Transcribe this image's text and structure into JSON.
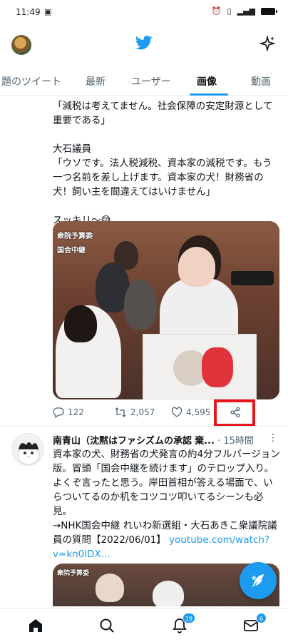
{
  "status_bar": {
    "time": "11:49",
    "left_icon": "sim-card-icon",
    "right_icons": [
      "alarm-icon",
      "vibrate-icon",
      "signal-icon",
      "battery-icon"
    ]
  },
  "header": {
    "logo": "twitter-bird-icon",
    "right_icon": "sparkle-icon"
  },
  "tabs": [
    {
      "label": "題のツイート",
      "active": false
    },
    {
      "label": "最新",
      "active": false
    },
    {
      "label": "ユーザー",
      "active": false
    },
    {
      "label": "画像",
      "active": true
    },
    {
      "label": "動画",
      "active": false
    }
  ],
  "tweet1": {
    "text": "「減税は考えてません。社会保障の安定財源として重要である」\n\n大石議員\n「ウソです。法人税減税、資本家の減税です。もう一つ名前を差し上げます。資本家の犬！財務省の犬！飼い主を間違えてはいけません」\n\nスッキリ〜😅",
    "media": {
      "label_top": "衆院予算委",
      "label_bottom": "国会中継"
    },
    "actions": {
      "replies": "122",
      "retweets": "2,057",
      "likes": "4,595"
    }
  },
  "tweet2": {
    "name": "南青山（沈黙はファシズムの承認",
    "name_suffix": "棄...",
    "time": "· 15時間",
    "more": "⋮",
    "text": "資本家の犬、財務省の犬発言の約4分フルバージョン版。冒頭「国会中継を続けます」のテロップ入り。よくぞ言ったと思う。岸田首相が答える場面で、いらついてるのか机をコツコツ叩いてるシーンも必見。\n→NHK国会中継 れいわ新選組・大石あきこ衆議院議員の質問【2022/06/01】",
    "link": "youtube.com/watch?v=kn0lDX...",
    "media_label": "衆院予算委"
  },
  "fab": {
    "icon": "compose-feather-icon"
  },
  "bottom_nav": {
    "items": [
      {
        "icon": "home-icon"
      },
      {
        "icon": "search-icon"
      },
      {
        "icon": "bell-icon",
        "badge": "19"
      },
      {
        "icon": "mail-icon",
        "badge": "6"
      }
    ]
  },
  "colors": {
    "accent": "#1d9bf0",
    "highlight": "#e8141c"
  }
}
